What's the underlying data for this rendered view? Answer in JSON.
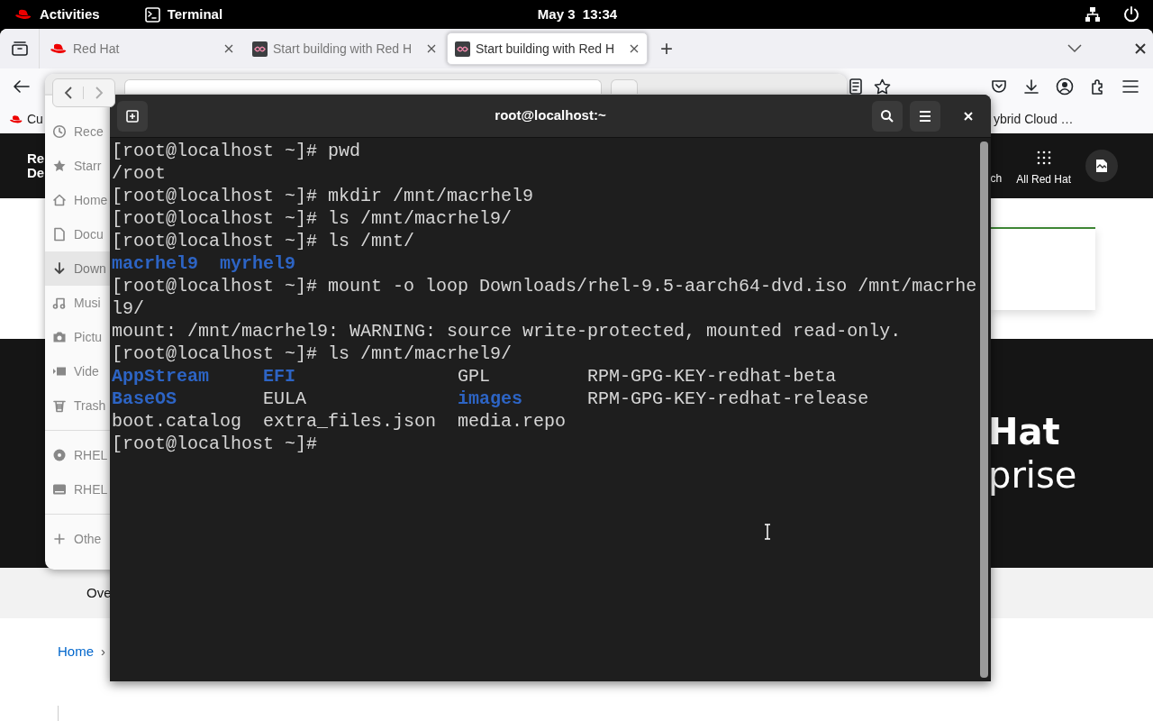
{
  "top_bar": {
    "activities": "Activities",
    "app": "Terminal",
    "clock": "May 3  13:34"
  },
  "browser": {
    "tabs": [
      {
        "title": "Red Hat",
        "selected": false
      },
      {
        "title": "Start building with Red H",
        "selected": false
      },
      {
        "title": "Start building with Red H",
        "selected": true
      }
    ],
    "new_tab": "+",
    "bookmarks": [
      "Cu",
      "ybrid Cloud …"
    ],
    "page": {
      "logo_lines": [
        "Re",
        "De"
      ],
      "search_label": "ch",
      "all_label": "All Red Hat",
      "hero_lines": [
        "Hat",
        "prise"
      ],
      "subnav": "Ove",
      "breadcrumb": "Home",
      "breadcrumb_separator": "›"
    }
  },
  "files": {
    "sidebar": [
      {
        "label": "Rece",
        "selected": false
      },
      {
        "label": "Starr",
        "selected": false
      },
      {
        "label": "Home",
        "selected": false
      },
      {
        "label": "Docu",
        "selected": false
      },
      {
        "label": "Down",
        "selected": true
      },
      {
        "label": "Musi",
        "selected": false
      },
      {
        "label": "Pictu",
        "selected": false
      },
      {
        "label": "Vide",
        "selected": false
      },
      {
        "label": "Trash",
        "selected": false
      },
      {
        "label": "RHEL",
        "selected": false
      },
      {
        "label": "RHEL",
        "selected": false
      },
      {
        "label": "Othe",
        "selected": false
      }
    ]
  },
  "terminal": {
    "title": "root@localhost:~",
    "lines": [
      [
        {
          "text": "[root@localhost ~]# pwd",
          "kind": "plain"
        }
      ],
      [
        {
          "text": "/root",
          "kind": "plain"
        }
      ],
      [
        {
          "text": "[root@localhost ~]# mkdir /mnt/macrhel9",
          "kind": "plain"
        }
      ],
      [
        {
          "text": "[root@localhost ~]# ls /mnt/macrhel9/",
          "kind": "plain"
        }
      ],
      [
        {
          "text": "[root@localhost ~]# ls /mnt/",
          "kind": "plain"
        }
      ],
      [
        {
          "text": "macrhel9  ",
          "kind": "dir"
        },
        {
          "text": "myrhel9",
          "kind": "dir"
        }
      ],
      [
        {
          "text": "[root@localhost ~]# mount -o loop Downloads/rhel-9.5-aarch64-dvd.iso /mnt/macrhe",
          "kind": "plain"
        }
      ],
      [
        {
          "text": "l9/",
          "kind": "plain"
        }
      ],
      [
        {
          "text": "mount: /mnt/macrhel9: WARNING: source write-protected, mounted read-only.",
          "kind": "plain"
        }
      ],
      [
        {
          "text": "[root@localhost ~]# ls /mnt/macrhel9/",
          "kind": "plain"
        }
      ],
      [
        {
          "text": "AppStream     ",
          "kind": "dir"
        },
        {
          "text": "EFI",
          "kind": "dir"
        },
        {
          "text": "               GPL         RPM-GPG-KEY-redhat-beta",
          "kind": "plain"
        }
      ],
      [
        {
          "text": "BaseOS",
          "kind": "dir"
        },
        {
          "text": "        EULA              ",
          "kind": "plain"
        },
        {
          "text": "images",
          "kind": "dir"
        },
        {
          "text": "      RPM-GPG-KEY-redhat-release",
          "kind": "plain"
        }
      ],
      [
        {
          "text": "boot.catalog  extra_files.json  media.repo",
          "kind": "plain"
        }
      ],
      [
        {
          "text": "[root@localhost ~]#",
          "kind": "plain"
        }
      ]
    ]
  }
}
